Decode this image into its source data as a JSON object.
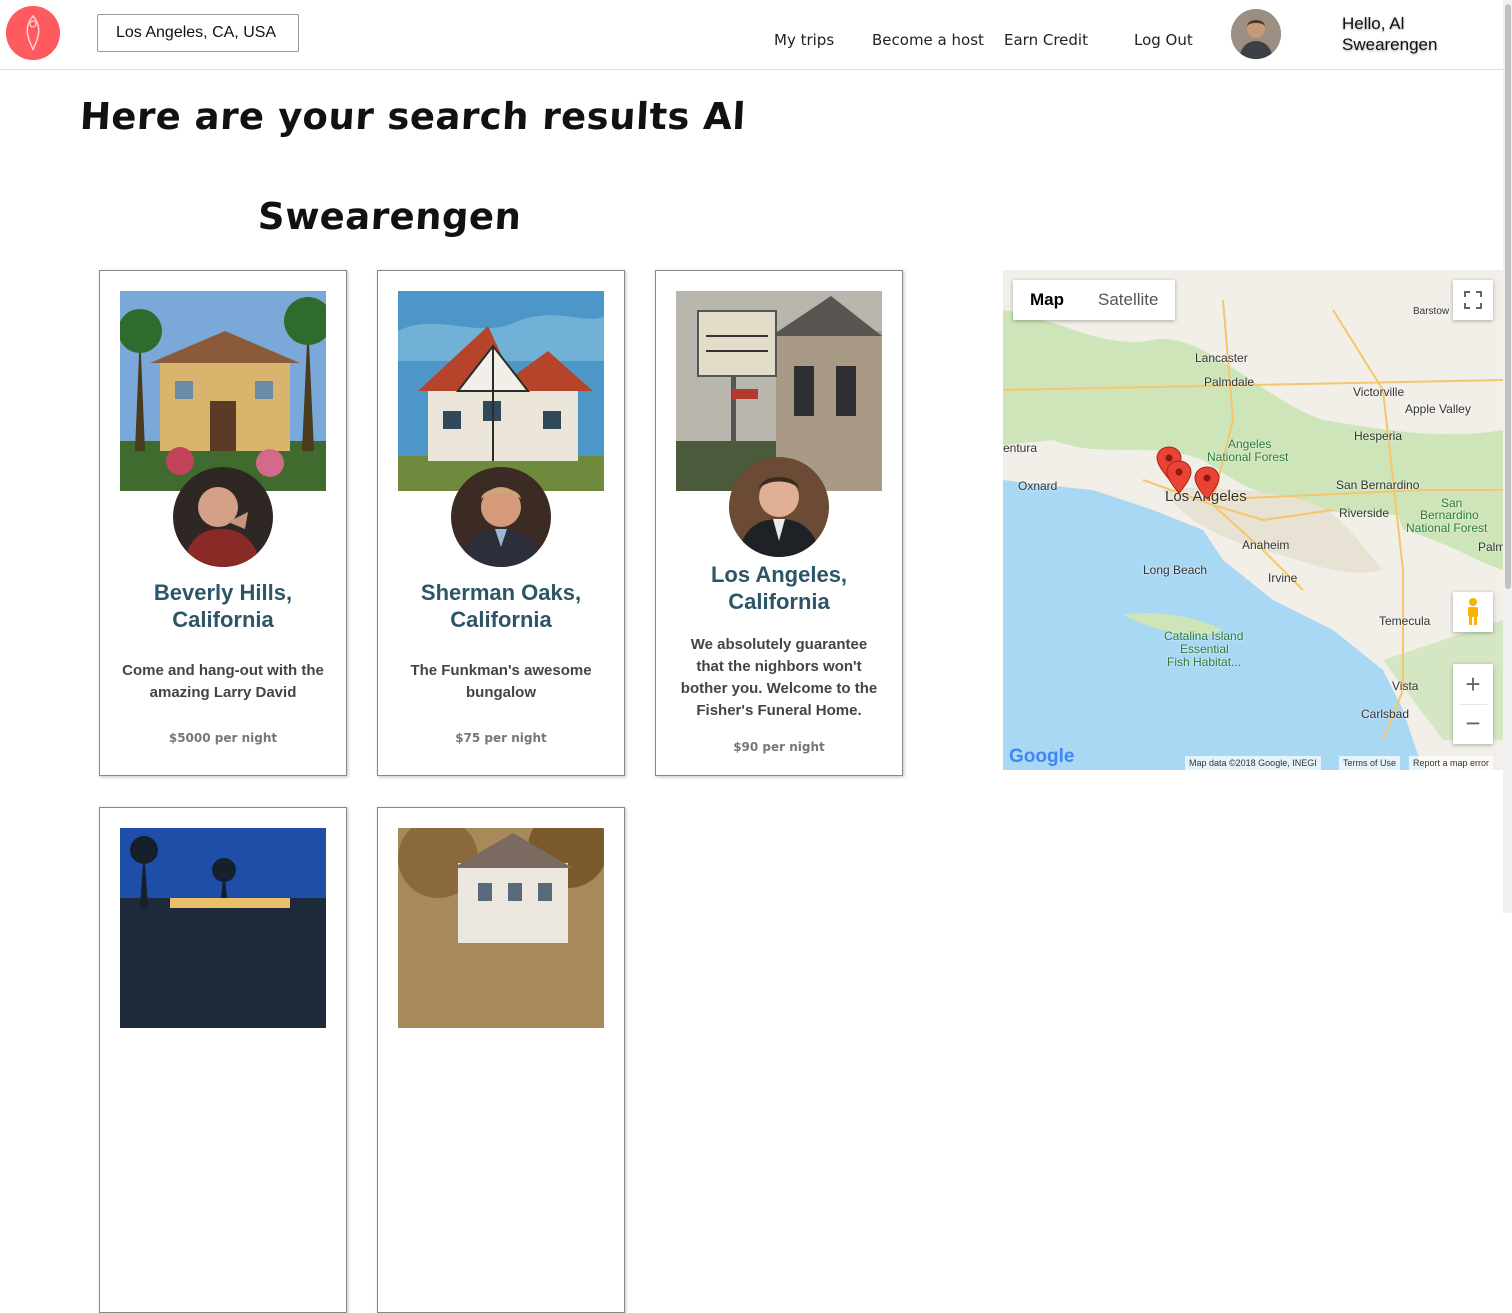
{
  "search": {
    "value": "Los Angeles, CA, USA"
  },
  "nav": {
    "my_trips": "My trips",
    "become_host": "Become a host",
    "earn_credit": "Earn Credit",
    "log_out": "Log Out",
    "hello_line1": "Hello, Al",
    "hello_line2": "Swearengen"
  },
  "heading": {
    "line1": "Here are your search results Al",
    "line2": "Swearengen"
  },
  "listings": [
    {
      "city_line1": "Beverly Hills,",
      "city_line2": "California",
      "desc_line1": "Come and hang-out with the",
      "desc_line2": "amazing Larry David",
      "price": "$5000 per night"
    },
    {
      "city_line1": "Sherman Oaks,",
      "city_line2": "California",
      "desc_line1": "The Funkman's awesome",
      "desc_line2": "bungalow",
      "price": "$75 per night"
    },
    {
      "city_line1": "Los Angeles,",
      "city_line2": "California",
      "desc_line1": "We absolutely guarantee",
      "desc_line2": "that the nighbors won't",
      "desc_line3": "bother you. Welcome to the",
      "desc_line4": "Fisher's Funeral Home.",
      "price": "$90 per night"
    }
  ],
  "map": {
    "tab_map": "Map",
    "tab_satellite": "Satellite",
    "labels": {
      "barstow": "Barstow",
      "lancaster": "Lancaster",
      "palmdale": "Palmdale",
      "victorville": "Victorville",
      "apple_valley": "Apple Valley",
      "hesperia": "Hesperia",
      "ventura": "entura",
      "oxnard": "Oxnard",
      "angeles_nf1": "Angeles",
      "angeles_nf2": "National Forest",
      "los_angeles": "Los Angeles",
      "san_bernardino": "San Bernardino",
      "riverside": "Riverside",
      "sbnf1": "San",
      "sbnf2": "Bernardino",
      "sbnf3": "National Forest",
      "anaheim": "Anaheim",
      "long_beach": "Long Beach",
      "irvine": "Irvine",
      "temecula": "Temecula",
      "catalina1": "Catalina Island",
      "catalina2": "Essential",
      "catalina3": "Fish Habitat...",
      "vista": "Vista",
      "carlsbad": "Carlsbad",
      "palm": "Palm"
    },
    "google": "Google",
    "map_data": "Map data ©2018 Google, INEGI",
    "terms": "Terms of Use",
    "report": "Report a map error"
  }
}
